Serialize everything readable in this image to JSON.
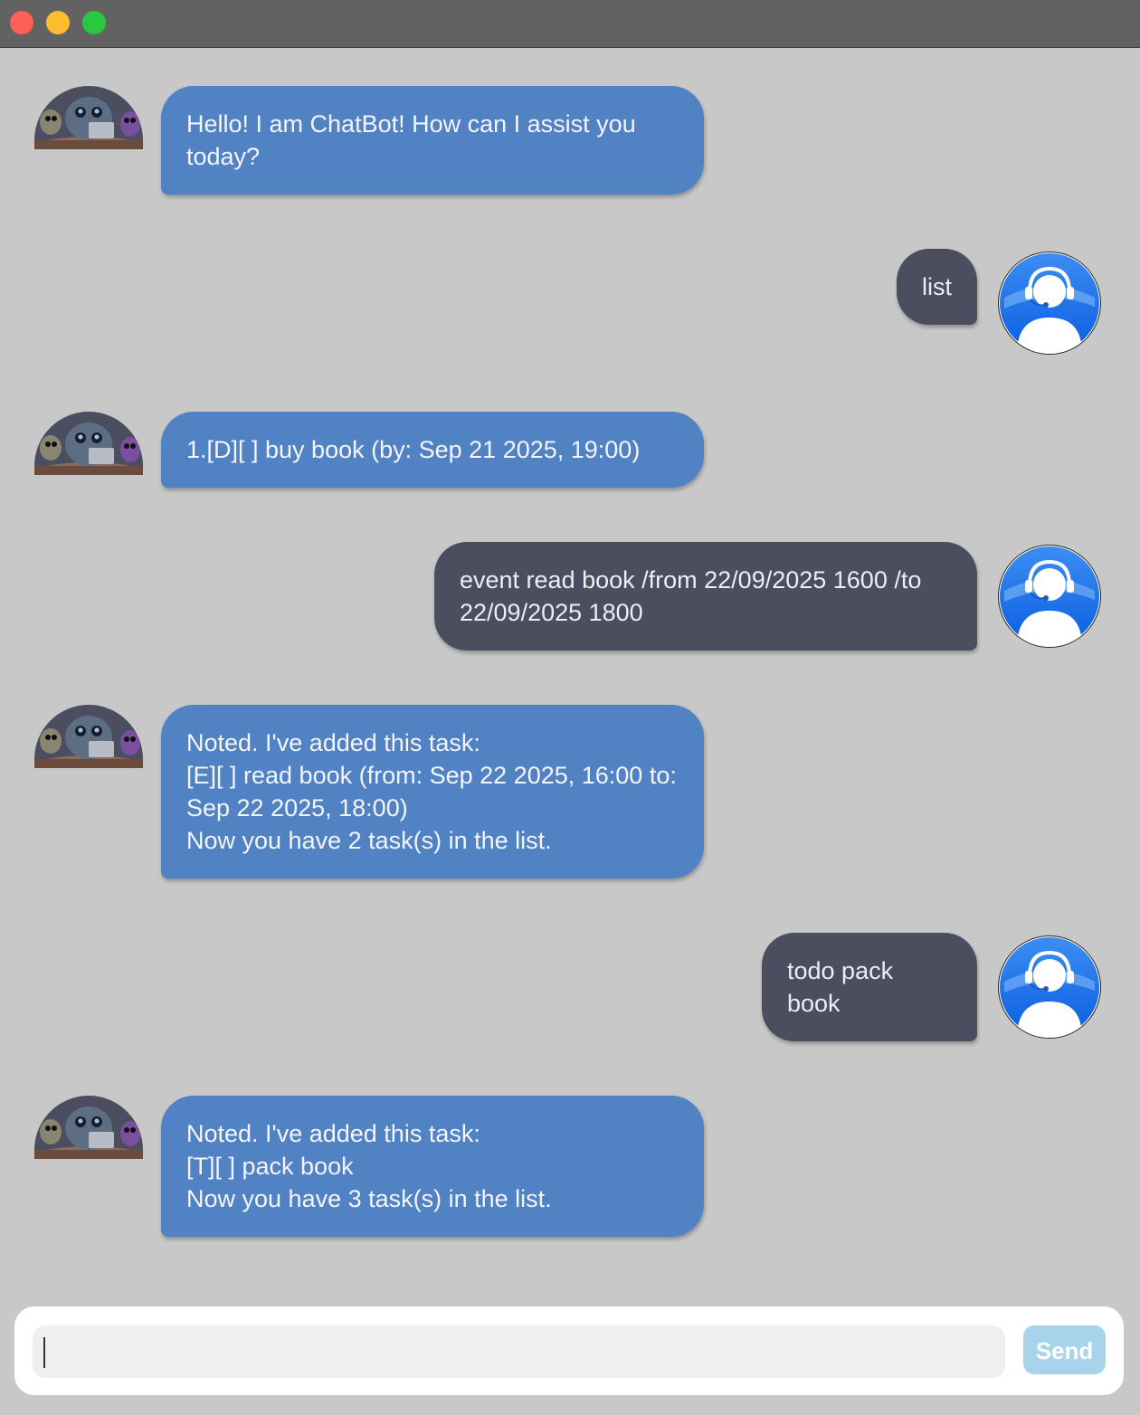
{
  "window": {
    "controls": [
      "close",
      "minimize",
      "maximize"
    ]
  },
  "messages": [
    {
      "sender": "bot",
      "text": "Hello! I am ChatBot! How can I assist you\ntoday?"
    },
    {
      "sender": "user",
      "text": "list"
    },
    {
      "sender": "bot",
      "text": "1.[D][ ] buy book (by: Sep 21 2025, 19:00)"
    },
    {
      "sender": "user",
      "text": "event read book /from 22/09/2025 1600 /to\n22/09/2025 1800"
    },
    {
      "sender": "bot",
      "text": "Noted. I've added this task:\n[E][ ] read book (from: Sep 22 2025, 16:00 to:\nSep 22 2025, 18:00)\nNow you have 2 task(s) in the list."
    },
    {
      "sender": "user",
      "text": "todo pack book"
    },
    {
      "sender": "bot",
      "text": "Noted. I've added this task:\n[T][ ] pack book\nNow you have 3 task(s) in the list."
    }
  ],
  "input": {
    "value": "",
    "placeholder": ""
  },
  "send_button": {
    "label": "Send"
  },
  "colors": {
    "bot_bubble": "#5182c4",
    "user_bubble": "#4b4e5f",
    "send_button": "#a8d3ea",
    "background": "#c8c8c8"
  },
  "icons": {
    "bot_avatar": "robot-avatar-icon",
    "user_avatar": "headset-user-avatar-icon"
  }
}
